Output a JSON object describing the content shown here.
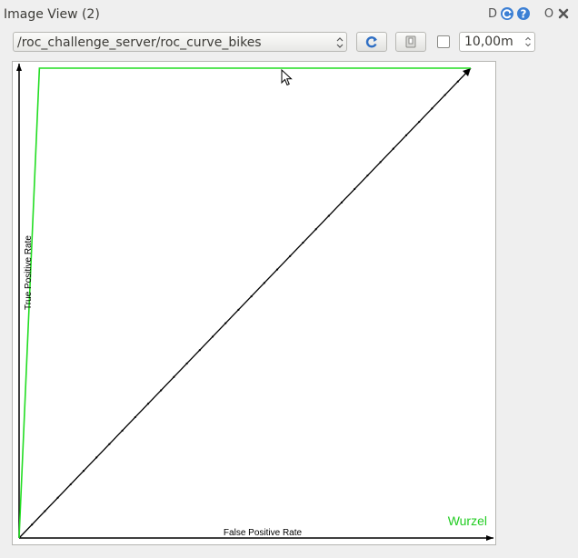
{
  "window": {
    "title": "Image View (2)",
    "controls": {
      "dock_label": "D",
      "reload_icon": "reload-icon",
      "help_icon": "help-icon",
      "options_label": "O",
      "close_icon": "close-icon"
    }
  },
  "toolbar": {
    "topic_value": "/roc_challenge_server/roc_curve_bikes",
    "refresh_icon": "refresh-icon",
    "save_icon": "save-image-icon",
    "smooth_checkbox_checked": false,
    "time_value": "10,00m"
  },
  "image": {
    "xlabel": "False Positive Rate",
    "ylabel": "True Positive Rate",
    "watermark": "Wurzel",
    "colors": {
      "curve": "#22dd22",
      "axes": "#000000",
      "watermark": "#22cc22"
    }
  },
  "chart_data": {
    "type": "line",
    "xlabel": "False Positive Rate",
    "ylabel": "True Positive Rate",
    "xlim": [
      0,
      1
    ],
    "ylim": [
      0,
      1
    ],
    "grid": false,
    "series": [
      {
        "x": [
          0,
          0.045,
          1.0
        ],
        "y": [
          0,
          1.0,
          1.0
        ]
      }
    ],
    "diagonal": {
      "x": [
        0,
        1
      ],
      "y": [
        0,
        1
      ]
    }
  }
}
